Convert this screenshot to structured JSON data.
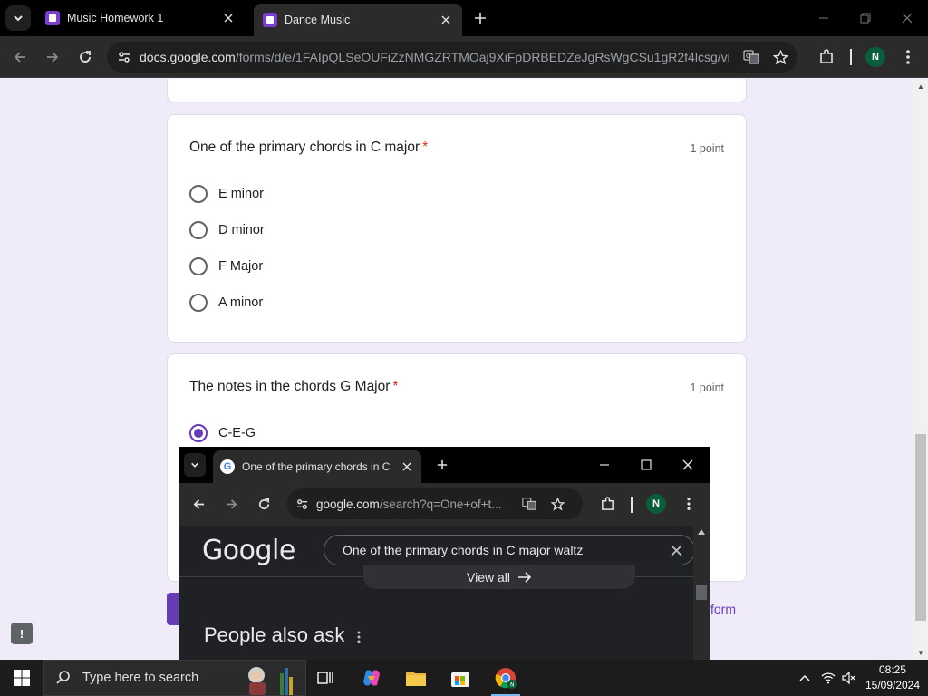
{
  "browser": {
    "tabs": [
      {
        "title": "Music Homework 1",
        "active": false
      },
      {
        "title": "Dance Music",
        "active": true
      }
    ],
    "url_host": "docs.google.com",
    "url_path": "/forms/d/e/1FAIpQLSeOUFiZzNMGZRTMOaj9XiFpDRBEDZeJgRsWgCSu1gR2f4lcsg/viewf...",
    "profile_initial": "N"
  },
  "form": {
    "question1": {
      "title": "One of the primary chords in C major",
      "required_mark": "*",
      "points": "1 point",
      "options": [
        "E minor",
        "D minor",
        "F Major",
        "A minor"
      ]
    },
    "question2": {
      "title": "The notes in the chords G Major",
      "required_mark": "*",
      "points": "1 point",
      "options": [
        "C-E-G"
      ],
      "selected": "C-E-G"
    },
    "clear_form_peek": "form",
    "feedback_icon": "!"
  },
  "popup": {
    "tab_title": "One of the primary chords in C",
    "url_host": "google.com",
    "url_path": "/search?q=One+of+t...",
    "profile_initial": "N",
    "logo": "Google",
    "search_query": "One of the primary chords in C major waltz",
    "view_all": "View all",
    "people_also_ask": "People also ask"
  },
  "taskbar": {
    "search_placeholder": "Type here to search",
    "time": "08:25",
    "date": "15/09/2024"
  },
  "colors": {
    "form_accent": "#673ab7",
    "form_background": "#f0ebf8",
    "required": "#d93025"
  }
}
